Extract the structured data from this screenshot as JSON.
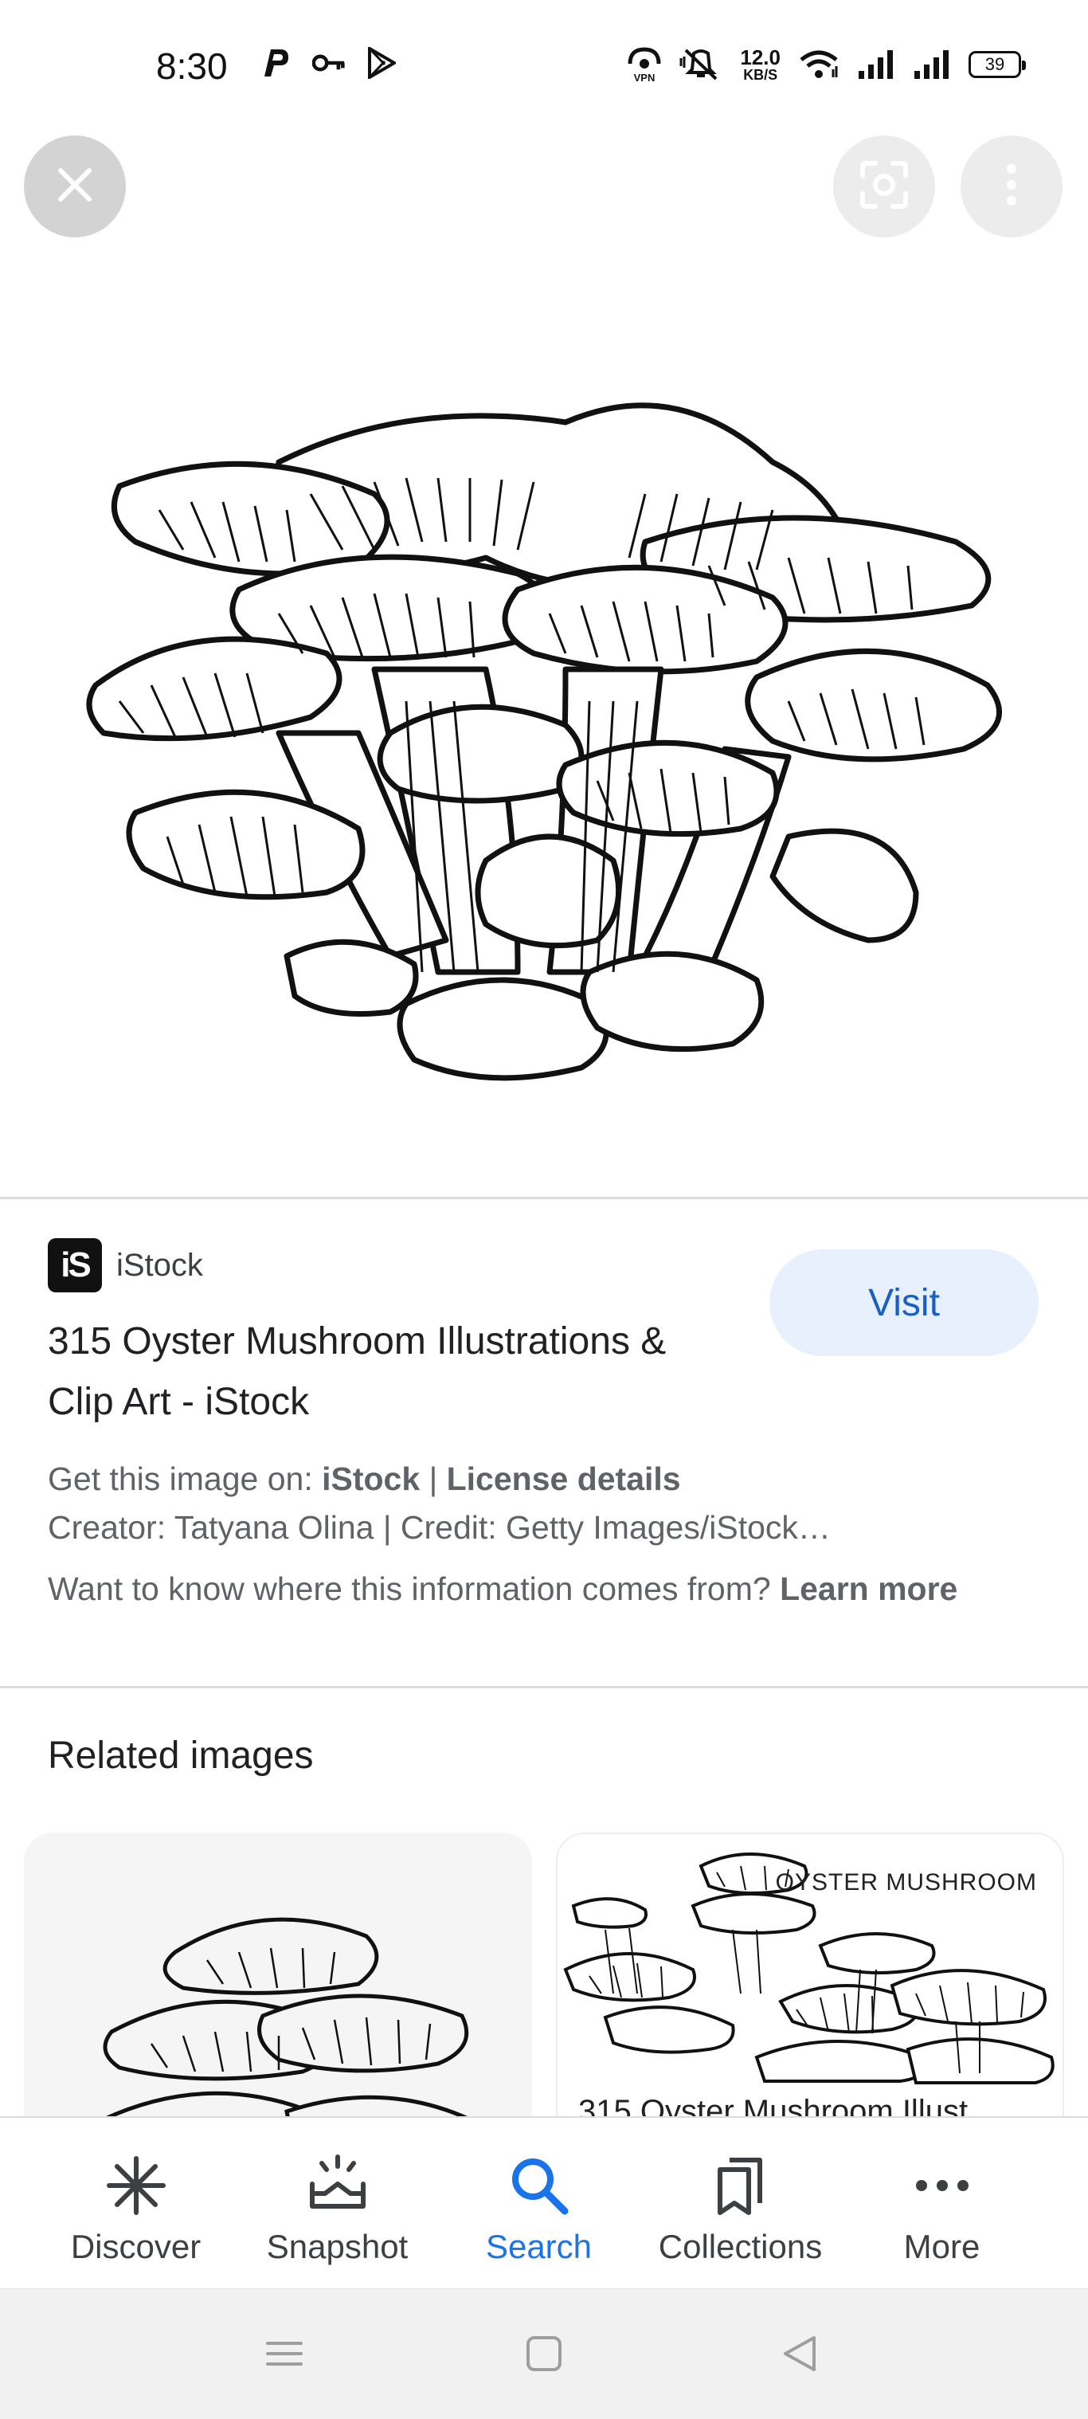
{
  "status_bar": {
    "time": "8:30",
    "net_speed_value": "12.0",
    "net_speed_unit": "KB/S",
    "battery": "39",
    "left_icons": [
      "parking-app-icon",
      "key-icon",
      "play-store-icon"
    ],
    "right_icons": [
      "vpn-icon",
      "mute-icon",
      "wifi-icon",
      "signal-icon",
      "signal-icon",
      "battery-icon"
    ]
  },
  "viewer": {
    "close_icon": "close-icon",
    "lens_icon": "lens-icon",
    "more_icon": "more-vert-icon"
  },
  "result": {
    "source_logo_text": "iS",
    "source_name": "iStock",
    "title": "315 Oyster Mushroom Illustrations & Clip Art - iStock",
    "visit_label": "Visit",
    "get_image_prefix": "Get this image on: ",
    "get_image_source": "iStock",
    "separator": " | ",
    "license_details": "License details",
    "creator_line": "Creator: Tatyana Olina | Credit: Getty Images/iStock…",
    "info_question": "Want to know where this information comes from? ",
    "learn_more": "Learn more"
  },
  "related": {
    "title": "Related images",
    "card2_overlay_text": "OYSTER MUSHROOM",
    "card2_caption": "315 Oyster Mushroom Illust..."
  },
  "bottom_nav": {
    "items": [
      {
        "label": "Discover",
        "icon": "asterisk-icon"
      },
      {
        "label": "Snapshot",
        "icon": "snapshot-icon"
      },
      {
        "label": "Search",
        "icon": "search-icon",
        "active": true
      },
      {
        "label": "Collections",
        "icon": "bookmarks-icon"
      },
      {
        "label": "More",
        "icon": "more-horiz-icon"
      }
    ]
  },
  "colors": {
    "accent": "#1a73e8",
    "visit_bg": "#e8f0fe",
    "visit_text": "#1a5fc4",
    "secondary_text": "#5f6368"
  }
}
